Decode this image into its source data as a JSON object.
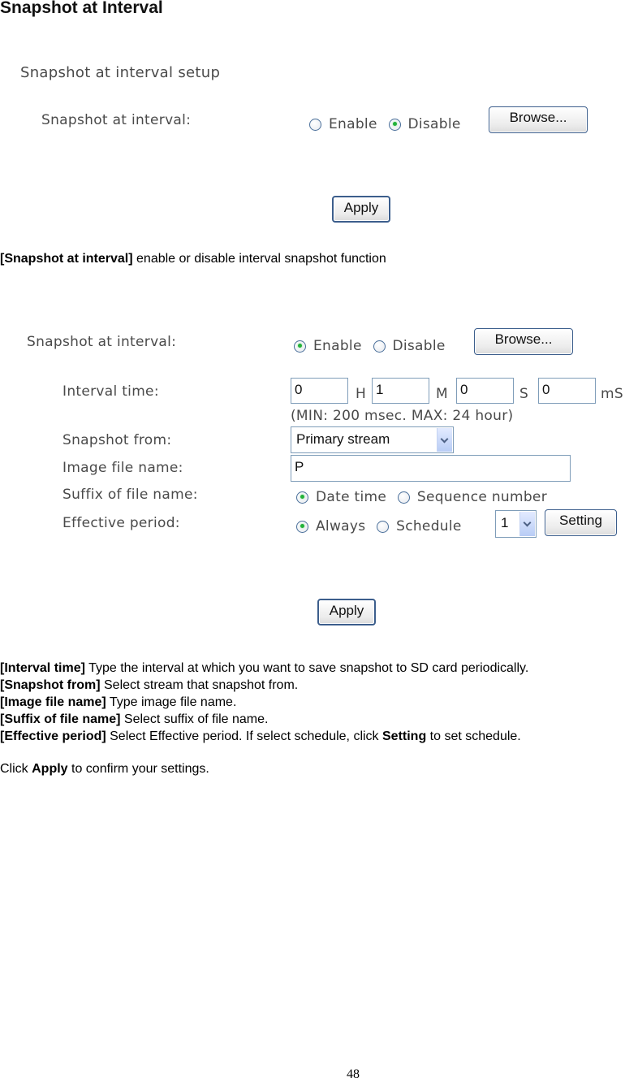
{
  "page_title": "Snapshot at Interval",
  "panel1": {
    "section_title": "Snapshot at interval setup",
    "snapshot_label": "Snapshot at interval:",
    "enable_label": "Enable",
    "disable_label": "Disable",
    "enable_selected": false,
    "disable_selected": true,
    "browse_label": "Browse...",
    "apply_label": "Apply"
  },
  "desc1": {
    "term": "[Snapshot at interval]",
    "text": " enable or disable interval snapshot function"
  },
  "panel2": {
    "snapshot_label": "Snapshot at interval:",
    "enable_label": "Enable",
    "disable_label": "Disable",
    "enable_selected": true,
    "disable_selected": false,
    "browse_label": "Browse...",
    "interval_label": "Interval time:",
    "hours_value": "0",
    "hours_unit": "H",
    "minutes_value": "1",
    "minutes_unit": "M",
    "seconds_value": "0",
    "seconds_unit": "S",
    "msec_value": "0",
    "msec_unit": "mS",
    "interval_hint": "(MIN: 200 msec. MAX: 24 hour)",
    "snapshot_from_label": "Snapshot from:",
    "snapshot_from_value": "Primary stream",
    "image_file_label": "Image file name:",
    "image_file_value": "P",
    "suffix_label": "Suffix of file name:",
    "suffix_options": [
      "Date time",
      "Sequence number"
    ],
    "suffix_selected": "Date time",
    "effective_label": "Effective period:",
    "effective_options": [
      "Always",
      "Schedule"
    ],
    "effective_selected": "Always",
    "schedule_value": "1",
    "setting_label": "Setting",
    "apply_label": "Apply"
  },
  "descriptions": [
    {
      "term": "[Interval time]",
      "text": " Type the interval at which you want to save snapshot to SD card periodically."
    },
    {
      "term": "[Snapshot from]",
      "text": " Select stream that snapshot from."
    },
    {
      "term": "[Image file name]",
      "text": " Type image file name."
    },
    {
      "term": "[Suffix of file name]",
      "text": " Select suffix of file name."
    },
    {
      "term": "[Effective period]",
      "text_before": " Select Effective period. If select schedule, click ",
      "bold": "Setting",
      "text_after": " to set schedule."
    }
  ],
  "footer_note": {
    "before": "Click ",
    "bold": "Apply",
    "after": " to confirm your settings."
  },
  "page_number": "48"
}
